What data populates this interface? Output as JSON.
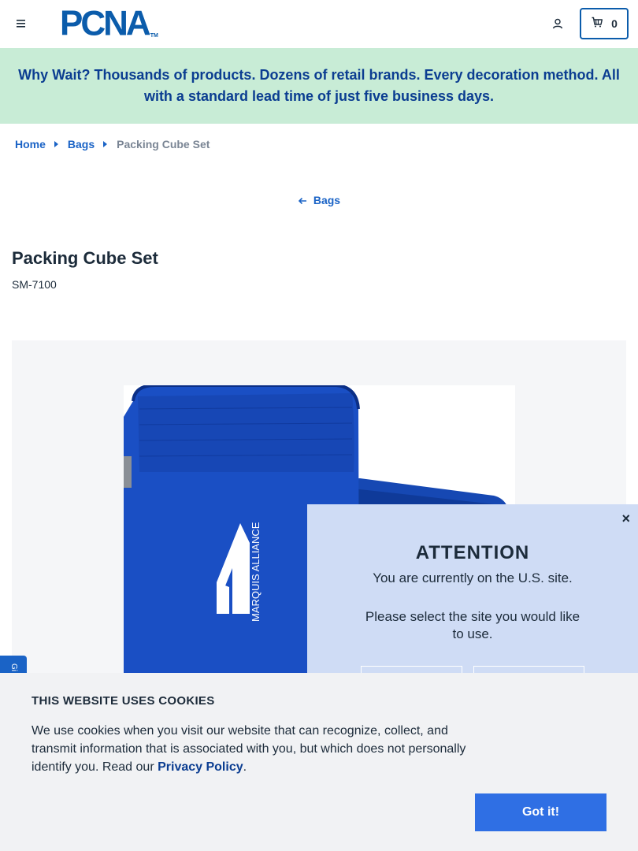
{
  "header": {
    "logo_text": "PCNA",
    "logo_tm": "TM",
    "cart_count": "0",
    "brand_color": "#0b5cab"
  },
  "promo": {
    "text": "Why Wait? Thousands of products. Dozens of retail brands. Every decoration method. All with a standard lead time of just five business days.",
    "background": "#c8ecd6"
  },
  "breadcrumb": {
    "items": [
      {
        "label": "Home"
      },
      {
        "label": "Bags"
      }
    ],
    "current": "Packing Cube Set"
  },
  "back_link": {
    "label": "Bags"
  },
  "product": {
    "title": "Packing Cube Set",
    "sku": "SM-7100",
    "image_brand_text": "MARQUIS ALLIANCE"
  },
  "side_tab": {
    "label": "Gi"
  },
  "attention": {
    "title": "ATTENTION",
    "subtitle": "You are currently on the U.S. site.",
    "prompt": "Please select the site you would like to use.",
    "close_label": "×"
  },
  "cookie": {
    "title": "THIS WEBSITE USES COOKIES",
    "text_before": "We use cookies when you visit our website that can recognize, collect, and transmit information that is associated with you, but which does not personally identify you. Read our ",
    "link_label": "Privacy Policy",
    "text_after": ".",
    "button_label": "Got it!"
  }
}
